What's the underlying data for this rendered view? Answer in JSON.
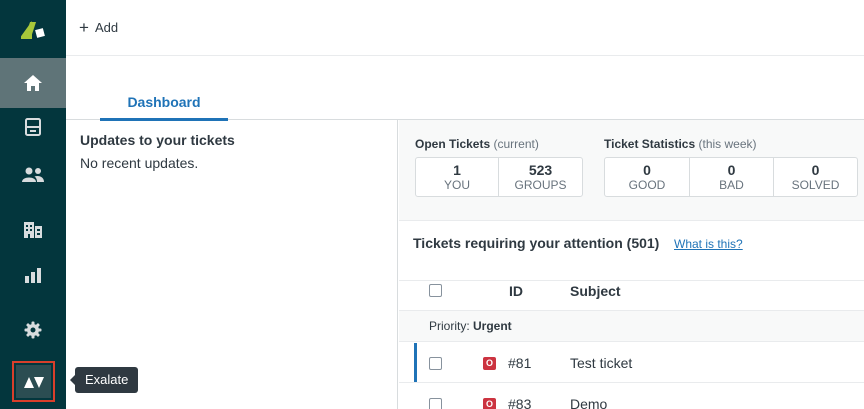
{
  "toolbar": {
    "add_label": "Add"
  },
  "tabs": [
    {
      "label": "Dashboard"
    }
  ],
  "updates": {
    "title": "Updates to your tickets",
    "empty_text": "No recent updates."
  },
  "open_tickets": {
    "title": "Open Tickets",
    "qualifier": "(current)",
    "cells": [
      {
        "value": "1",
        "label": "YOU"
      },
      {
        "value": "523",
        "label": "GROUPS"
      }
    ]
  },
  "ticket_stats": {
    "title": "Ticket Statistics",
    "qualifier": "(this week)",
    "cells": [
      {
        "value": "0",
        "label": "GOOD"
      },
      {
        "value": "0",
        "label": "BAD"
      },
      {
        "value": "0",
        "label": "SOLVED"
      }
    ]
  },
  "attention": {
    "title": "Tickets requiring your attention (501)",
    "link": "What is this?"
  },
  "table": {
    "columns": [
      "ID",
      "Subject"
    ],
    "group_prefix": "Priority:",
    "group_value": "Urgent",
    "rows": [
      {
        "status": "O",
        "id": "#81",
        "subject": "Test ticket"
      },
      {
        "status": "O",
        "id": "#83",
        "subject": "Demo"
      }
    ]
  },
  "sidebar": {
    "items": [
      {
        "name": "home-icon"
      },
      {
        "name": "views-icon"
      },
      {
        "name": "customers-icon"
      },
      {
        "name": "organizations-icon"
      },
      {
        "name": "reporting-icon"
      },
      {
        "name": "admin-gear-icon"
      }
    ],
    "app_tooltip": "Exalate"
  },
  "colors": {
    "sidebar": "#03363d",
    "active_nav": "#5f7478",
    "accent": "#1f73b7",
    "highlight_border": "#d93f2b",
    "status_open": "#cc3340"
  }
}
